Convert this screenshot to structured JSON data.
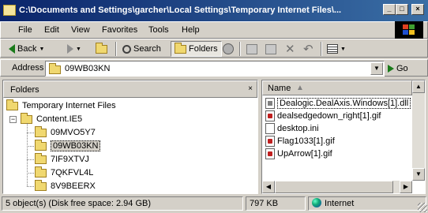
{
  "window": {
    "title": "C:\\Documents and Settings\\garcher\\Local Settings\\Temporary Internet Files\\..."
  },
  "menu": [
    "File",
    "Edit",
    "View",
    "Favorites",
    "Tools",
    "Help"
  ],
  "toolbar": {
    "back_label": "Back",
    "search_label": "Search",
    "folders_label": "Folders"
  },
  "address": {
    "label": "Address",
    "value": "09WB03KN",
    "go_label": "Go"
  },
  "folders_pane": {
    "title": "Folders",
    "close_glyph": "×",
    "tree": [
      {
        "label": "Temporary Internet Files",
        "level": 0,
        "expander": "",
        "selected": false
      },
      {
        "label": "Content.IE5",
        "level": 1,
        "expander": "−",
        "selected": false
      },
      {
        "label": "09MVO5Y7",
        "level": 2,
        "expander": "",
        "selected": false
      },
      {
        "label": "09WB03KN",
        "level": 2,
        "expander": "",
        "selected": true
      },
      {
        "label": "7IF9XTVJ",
        "level": 2,
        "expander": "",
        "selected": false
      },
      {
        "label": "7QKFVL4L",
        "level": 2,
        "expander": "",
        "selected": false
      },
      {
        "label": "8V9BEERX",
        "level": 2,
        "expander": "",
        "selected": false
      }
    ]
  },
  "files_pane": {
    "column_name": "Name",
    "sort_glyph": "▲",
    "files": [
      {
        "name": "Dealogic.DealAxis.Windows[1].dll",
        "icon": "dll-file-icon",
        "focused": true
      },
      {
        "name": "dealsedgedown_right[1].gif",
        "icon": "gif-file-icon",
        "focused": false
      },
      {
        "name": "desktop.ini",
        "icon": "ini-file-icon",
        "focused": false
      },
      {
        "name": "Flag1033[1].gif",
        "icon": "gif-file-icon",
        "focused": false
      },
      {
        "name": "UpArrow[1].gif",
        "icon": "gif-file-icon",
        "focused": false
      }
    ]
  },
  "status": {
    "objects": "5 object(s) (Disk free space: 2.94 GB)",
    "size": "797 KB",
    "zone": "Internet"
  },
  "colors": {
    "title_start": "#0a246a",
    "title_end": "#3a6ea5",
    "face": "#d4d0c8"
  }
}
